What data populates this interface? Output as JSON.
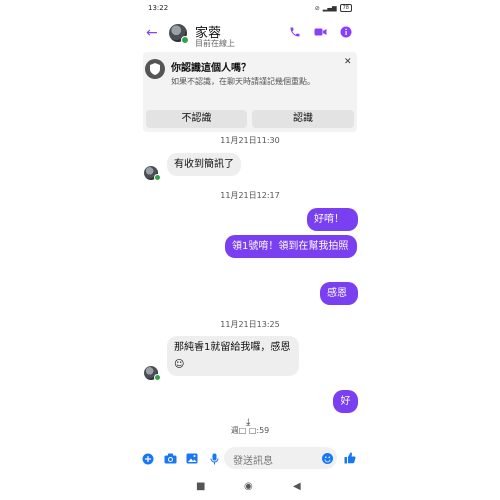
{
  "status": {
    "time": "13:22",
    "battery": "78"
  },
  "header": {
    "contact_name": "家蓉",
    "presence": "目前在線上"
  },
  "identity_card": {
    "title": "你認識這個人嗎？",
    "text": "如果不認識，在聊天時請謹記幾個重點。",
    "decline_label": "不認識",
    "accept_label": "認識"
  },
  "messages": {
    "ts1": "11月21日11:30",
    "m1": "有收到簡訊了",
    "ts2": "11月21日12:17",
    "m2": "好唷！",
    "m3": "領1號唷！領到在幫我拍照",
    "m4": "感恩",
    "ts3": "11月21日13:25",
    "m5": "那純睿1就留給我囉，感恩☺",
    "m6": "好",
    "ts4": "週□ □:59"
  },
  "composer": {
    "placeholder": "發送訊息"
  },
  "colors": {
    "accent": "#7a3ff1",
    "messenger_blue": "#1877f2"
  }
}
